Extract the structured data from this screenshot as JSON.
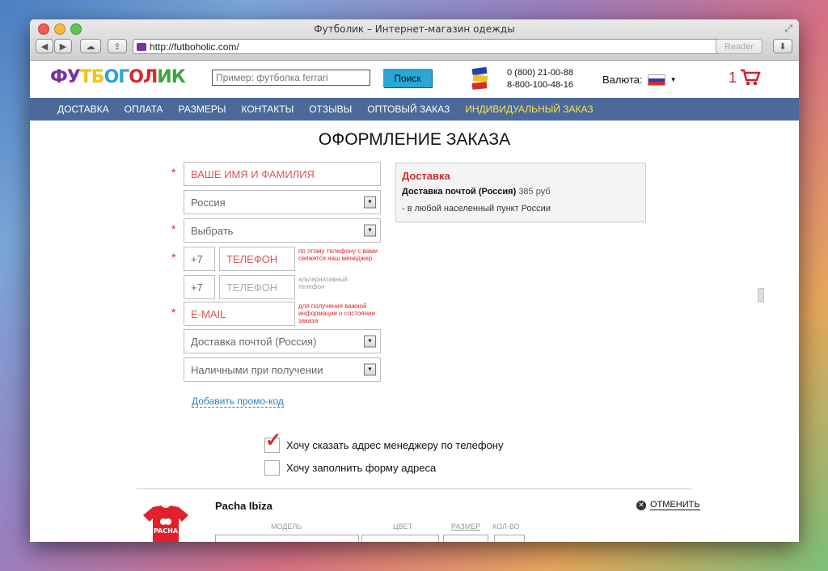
{
  "browser": {
    "window_title": "Футболик – Интернет-магазин одежды",
    "url": "http://futboholic.com/",
    "reader_label": "Reader"
  },
  "header": {
    "logo_text": "ФУТБОГОЛИК",
    "search_placeholder": "Пример: футболка ferrari",
    "search_button": "Поиск",
    "phone1": "0 (800) 21-00-88",
    "phone2": "8-800-100-48-16",
    "currency_label": "Валюта:",
    "cart_count": "1"
  },
  "nav": {
    "items": [
      "ДОСТАВКА",
      "ОПЛАТА",
      "РАЗМЕРЫ",
      "КОНТАКТЫ",
      "ОТЗЫВЫ",
      "ОПТОВЫЙ ЗАКАЗ",
      "ИНДИВИДУАЛЬНЫЙ ЗАКАЗ"
    ]
  },
  "form": {
    "title": "ОФОРМЛЕНИЕ ЗАКАЗА",
    "name_placeholder": "ВАШЕ ИМЯ И ФАМИЛИЯ",
    "country": "Россия",
    "city": "Выбрать",
    "phone_code": "+7",
    "phone_placeholder": "ТЕЛЕФОН",
    "phone_hint": "по этому телефону с вами свяжется наш менеджер",
    "alt_phone_code": "+7",
    "alt_phone_placeholder": "ТЕЛЕФОН",
    "alt_phone_hint": "альтернативный телефон",
    "email_placeholder": "E-MAIL",
    "email_hint": "для получения важной информации о состоянии заказа",
    "delivery_method": "Доставка почтой (Россия)",
    "payment_method": "Наличными при получении",
    "promo_link": "Добавить промо-код",
    "required_mark": "*"
  },
  "delivery": {
    "heading": "Доставка",
    "method": "Доставка почтой (Россия)",
    "price": "385 руб",
    "note": "- в любой населенный пункт России"
  },
  "options": {
    "tell_address": "Хочу сказать адрес менеджеру по телефону",
    "fill_address": "Хочу заполнить форму адреса",
    "tell_address_checked": true,
    "fill_address_checked": false
  },
  "product": {
    "name": "Pacha Ibiza",
    "cancel_label": "отменить",
    "col_model": "МОДЕЛЬ",
    "col_color": "ЦВЕТ",
    "col_size": "РАЗМЕР",
    "col_qty": "КОЛ-ВО",
    "shirt_text": "PACHA"
  },
  "colors": {
    "accent_blue": "#2aa6d7",
    "nav_bg": "#4b6a9b",
    "nav_active": "#ffe14a",
    "required_red": "#d42b2b"
  }
}
